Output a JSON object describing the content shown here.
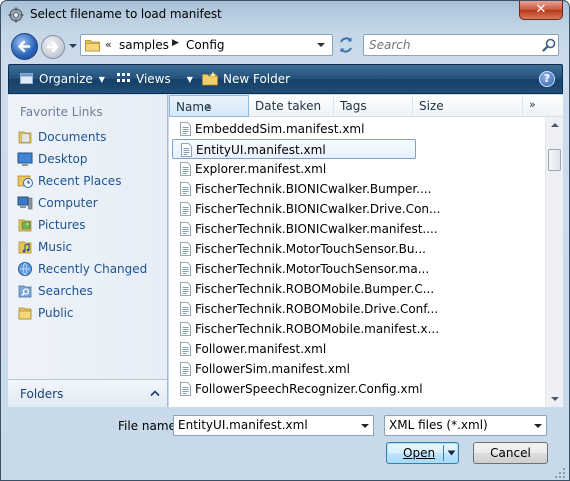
{
  "window": {
    "title": "Select filename to load manifest",
    "close_glyph": "✕"
  },
  "address": {
    "overflow": "«",
    "crumbs": [
      "samples",
      "Config"
    ],
    "separator": "▶"
  },
  "search": {
    "placeholder": "Search"
  },
  "toolbar": {
    "organize_label": "Organize",
    "views_label": "Views",
    "new_folder_label": "New Folder",
    "help_glyph": "?"
  },
  "nav": {
    "heading": "Favorite Links",
    "links": [
      {
        "label": "Documents",
        "icon": "documents-icon"
      },
      {
        "label": "Desktop",
        "icon": "desktop-icon"
      },
      {
        "label": "Recent Places",
        "icon": "recent-places-icon"
      },
      {
        "label": "Computer",
        "icon": "computer-icon"
      },
      {
        "label": "Pictures",
        "icon": "pictures-icon"
      },
      {
        "label": "Music",
        "icon": "music-icon"
      },
      {
        "label": "Recently Changed",
        "icon": "recently-changed-icon"
      },
      {
        "label": "Searches",
        "icon": "searches-icon"
      },
      {
        "label": "Public",
        "icon": "public-icon"
      }
    ],
    "folders_label": "Folders"
  },
  "columns": {
    "name": "Name",
    "date": "Date taken",
    "tags": "Tags",
    "size": "Size",
    "more": "»"
  },
  "files": [
    "EmbeddedSim.manifest.xml",
    "EntityUI.manifest.xml",
    "Explorer.manifest.xml",
    "FischerTechnik.BIONICwalker.Bumper....",
    "FischerTechnik.BIONICwalker.Drive.Con...",
    "FischerTechnik.BIONICwalker.manifest....",
    "FischerTechnik.MotorTouchSensor.Bu...",
    "FischerTechnik.MotorTouchSensor.ma...",
    "FischerTechnik.ROBOMobile.Bumper.C...",
    "FischerTechnik.ROBOMobile.Drive.Conf...",
    "FischerTechnik.ROBOMobile.manifest.x...",
    "Follower.manifest.xml",
    "FollowerSim.manifest.xml",
    "FollowerSpeechRecognizer.Config.xml"
  ],
  "selected_index": 1,
  "footer": {
    "filename_label": "File name:",
    "filename_value": "EntityUI.manifest.xml",
    "filetype_value": "XML files (*.xml)",
    "open_label": "Open",
    "cancel_label": "Cancel"
  },
  "colors": {
    "link": "#1c5391",
    "toolbar": "#22507a",
    "selection_border": "#7da2ce"
  }
}
